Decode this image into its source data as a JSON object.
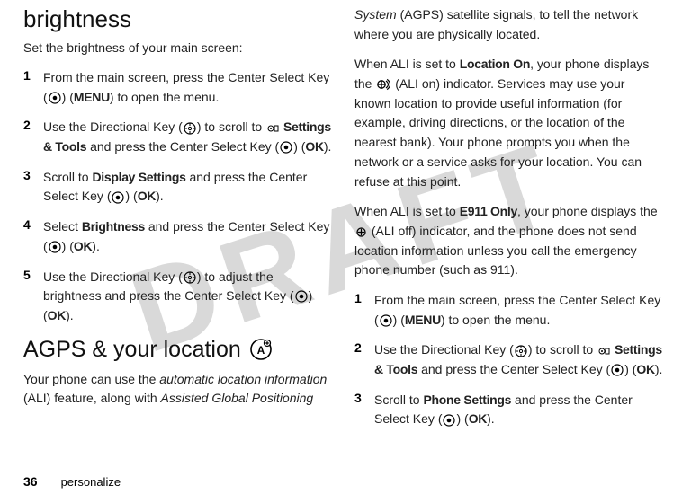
{
  "watermark": "DRAFT",
  "left": {
    "heading1": "brightness",
    "subhead": "Set the brightness of your main screen:",
    "steps": [
      {
        "num": "1",
        "pre": "From the main screen, press the Center Select Key (",
        "mid": ") (",
        "menu": "MENU",
        "post": ") to open the menu."
      },
      {
        "num": "2",
        "pre": "Use the Directional Key (",
        "mid": ") to scroll to ",
        "label": "Settings & Tools",
        "mid2": " and press the Center Select Key (",
        "ok": "OK",
        "post": ")."
      },
      {
        "num": "3",
        "pre": "Scroll to ",
        "label": "Display Settings",
        "mid": " and press the Center Select Key (",
        "ok": "OK",
        "post": ")."
      },
      {
        "num": "4",
        "pre": "Select ",
        "label": "Brightness",
        "mid": " and press the Center Select Key (",
        "ok": "OK",
        "post": ")."
      },
      {
        "num": "5",
        "pre": "Use the Directional Key (",
        "mid": ") to adjust the brightness and press the Center Select Key (",
        "ok": "OK",
        "post": ")."
      }
    ],
    "heading2": "AGPS & your location",
    "para1a": "Your phone can use the ",
    "para1b": "automatic location information",
    "para1c": " (ALI) feature, along with ",
    "para1d": "Assisted Global Positioning"
  },
  "right": {
    "para2a": "System",
    "para2b": " (AGPS) satellite signals, to tell the network where you are physically located.",
    "para3a": "When ALI is set to ",
    "para3label": "Location On",
    "para3b": ", your phone displays the ",
    "para3c": " (ALI on) indicator. Services may use your known location to provide useful information (for example, driving directions, or the location of the nearest bank). Your phone prompts you when the network or a service asks for your location. You can refuse at this point.",
    "para4a": "When ALI is set to ",
    "para4label": "E911 Only",
    "para4b": ", your phone displays the ",
    "para4c": " (ALI off) indicator, and the phone does not send location information unless you call the emergency phone number (such as 911).",
    "steps": [
      {
        "num": "1",
        "pre": "From the main screen, press the Center Select Key (",
        "mid": ") (",
        "menu": "MENU",
        "post": ") to open the menu."
      },
      {
        "num": "2",
        "pre": "Use the Directional Key (",
        "mid": ") to scroll to ",
        "label": "Settings & Tools",
        "mid2": " and press the Center Select Key (",
        "ok": "OK",
        "post": ")."
      },
      {
        "num": "3",
        "pre": "Scroll to ",
        "label": "Phone Settings",
        "mid": " and press the Center Select Key (",
        "ok": "OK",
        "post": ")."
      }
    ]
  },
  "footer": {
    "page": "36",
    "section": "personalize"
  }
}
